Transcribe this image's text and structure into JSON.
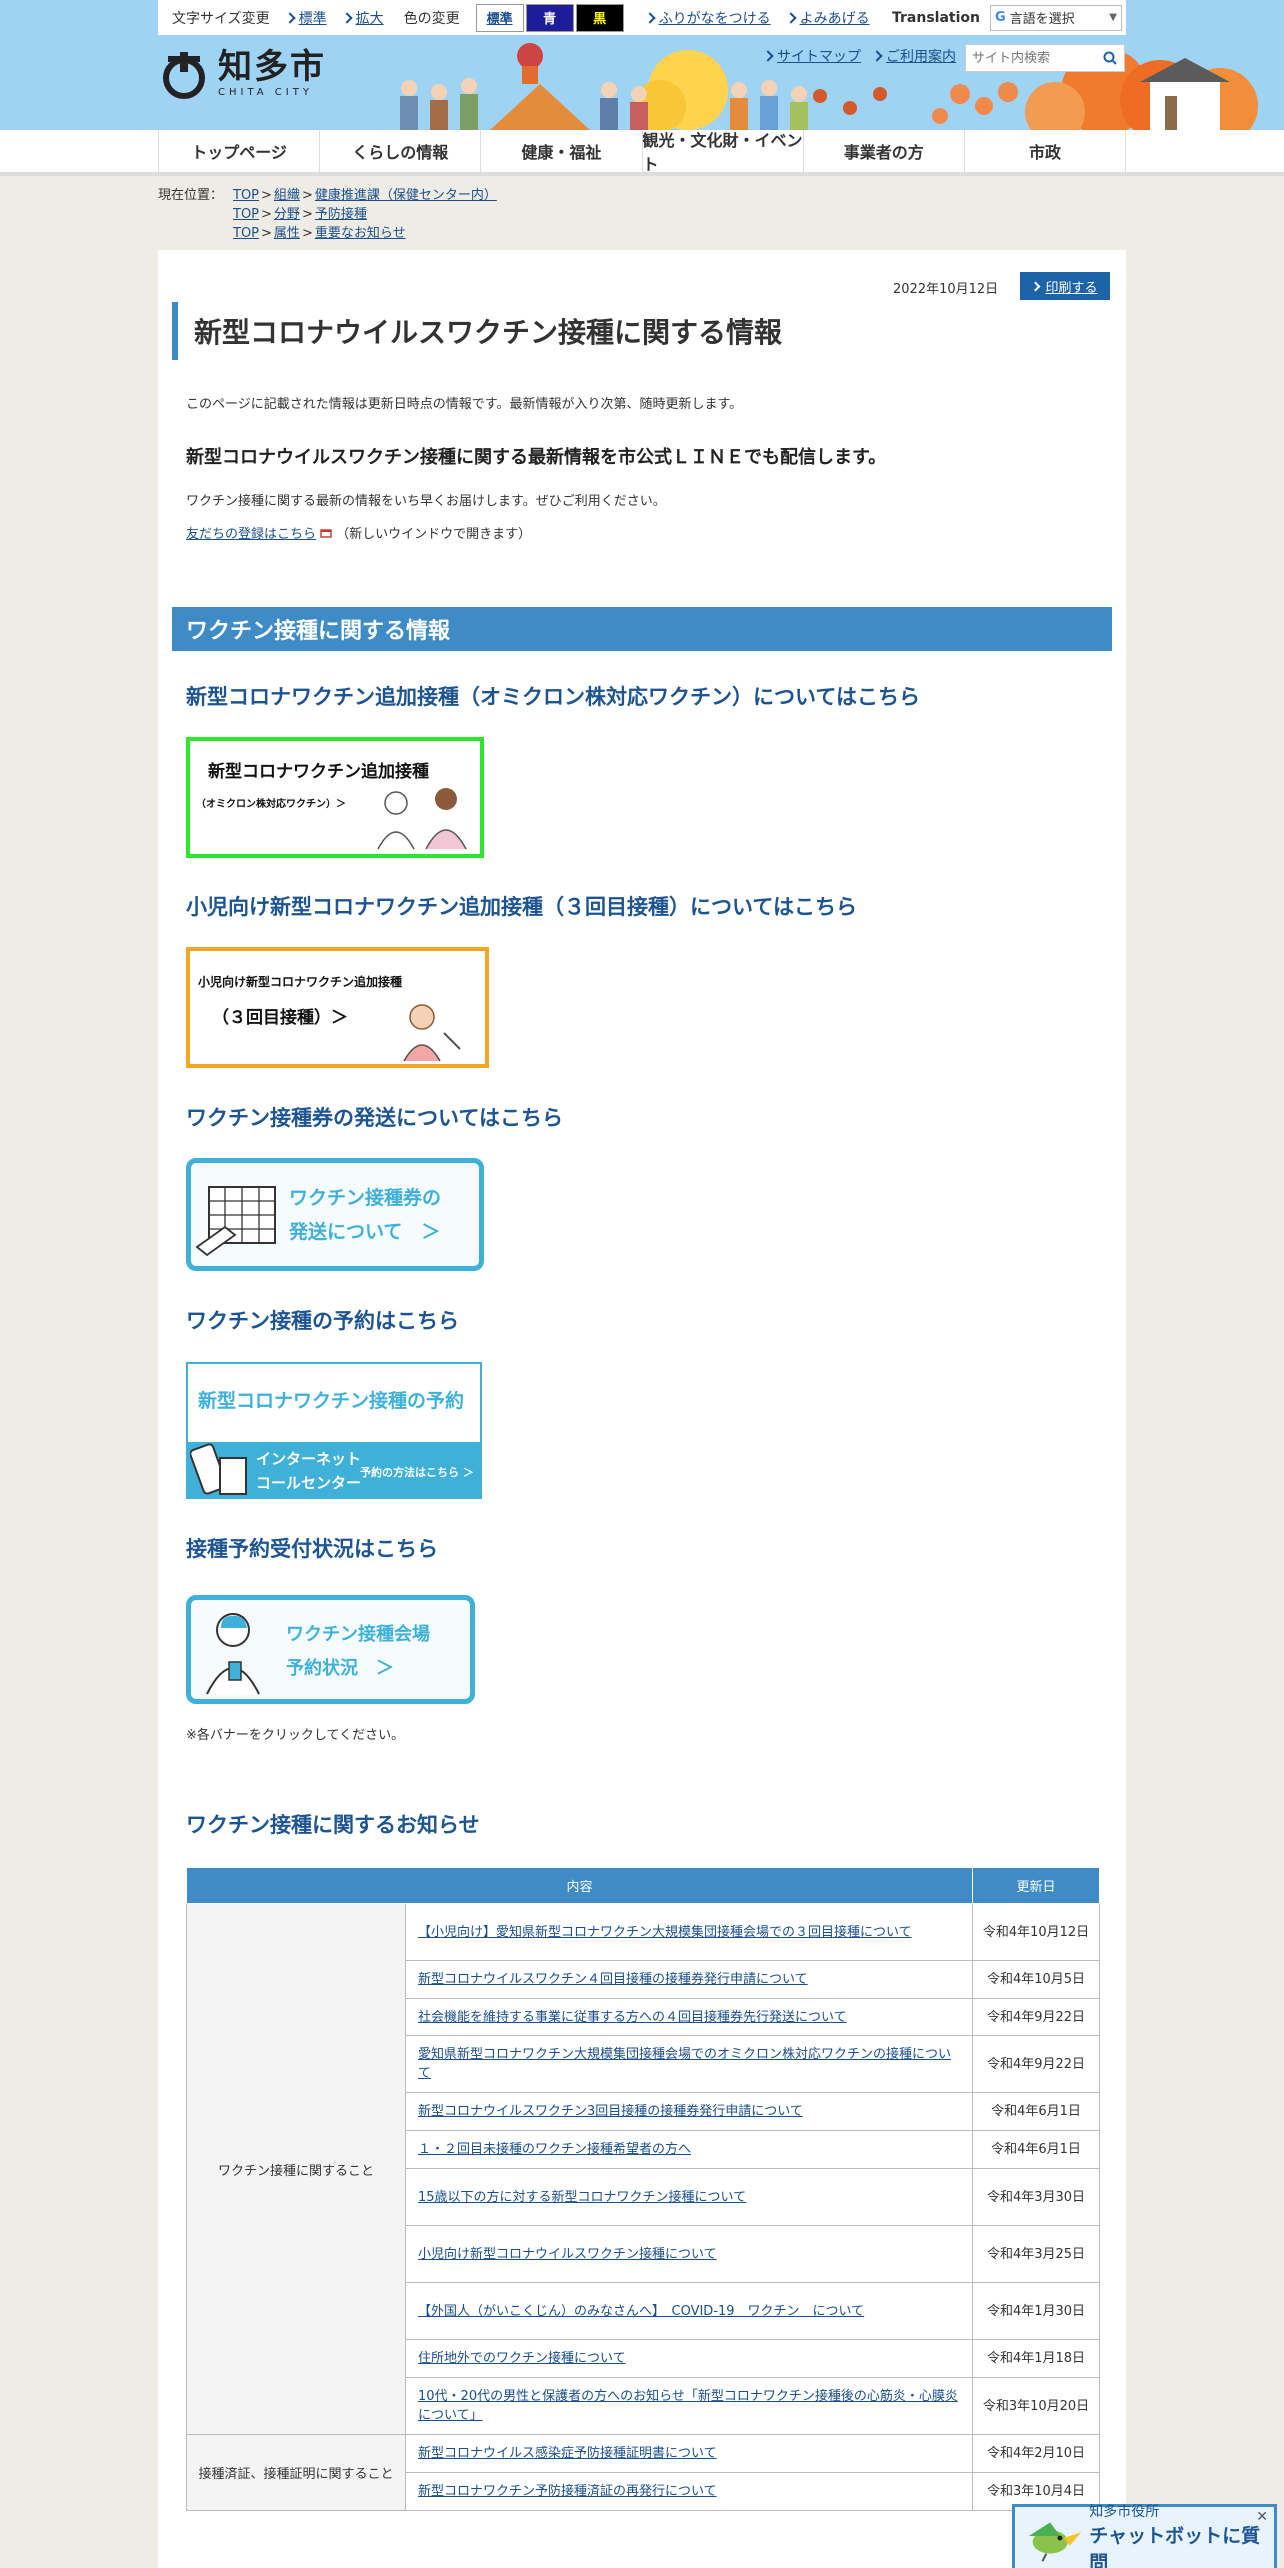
{
  "toolbar": {
    "font_size_label": "文字サイズ変更",
    "font_standard": "標準",
    "font_large": "拡大",
    "color_label": "色の変更",
    "color_standard": "標準",
    "color_blue": "青",
    "color_black": "黒",
    "furigana": "ふりがなをつける",
    "read_aloud": "よみあげる",
    "translation": "Translation",
    "language_select": "言語を選択"
  },
  "header": {
    "logo_jp": "知多市",
    "logo_en": "CHITA CITY",
    "sitemap": "サイトマップ",
    "guide": "ご利用案内",
    "search_placeholder": "サイト内検索"
  },
  "nav": [
    "トップページ",
    "くらしの情報",
    "健康・福祉",
    "観光・文化財・イベント",
    "事業者の方",
    "市政"
  ],
  "breadcrumb": {
    "label": "現在位置：",
    "rows": [
      [
        "TOP",
        "組織",
        "健康推進課（保健センター内）"
      ],
      [
        "TOP",
        "分野",
        "予防接種"
      ],
      [
        "TOP",
        "属性",
        "重要なお知らせ"
      ]
    ]
  },
  "page": {
    "date": "2022年10月12日",
    "print": "印刷する",
    "title": "新型コロナウイルスワクチン接種に関する情報",
    "intro": "このページに記載された情報は更新日時点の情報です。最新情報が入り次第、随時更新します。",
    "line_heading": "新型コロナウイルスワクチン接種に関する最新情報を市公式ＬＩＮＥでも配信します。",
    "line_desc": "ワクチン接種に関する最新の情報をいち早くお届けします。ぜひご利用ください。",
    "line_link": "友だちの登録はこちら",
    "line_link_note": "（新しいウインドウで開きます）",
    "section_title": "ワクチン接種に関する情報",
    "note": "※各バナーをクリックしてください。",
    "notice_title": "ワクチン接種に関するお知らせ"
  },
  "sections": [
    {
      "heading": "新型コロナワクチン追加接種（オミクロン株対応ワクチン）についてはこちら",
      "banner_line1": "新型コロナワクチン追加接種",
      "banner_line2": "（オミクロン株対応ワクチン）＞"
    },
    {
      "heading": "小児向け新型コロナワクチン追加接種（３回目接種）についてはこちら",
      "banner_line1": "小児向け新型コロナワクチン追加接種",
      "banner_line2": "（３回目接種）＞"
    },
    {
      "heading": "ワクチン接種券の発送についてはこちら",
      "banner_line1": "ワクチン接種券の",
      "banner_line2": "発送について　＞"
    },
    {
      "heading": "ワクチン接種の予約はこちら",
      "banner_line1": "新型コロナワクチン接種の予約",
      "banner_line2": "インターネット",
      "banner_line3": "コールセンター",
      "banner_line4": "予約の方法はこちら ＞"
    },
    {
      "heading": "接種予約受付状況はこちら",
      "banner_line1": "ワクチン接種会場",
      "banner_line2": "予約状況　＞"
    }
  ],
  "table": {
    "headers": [
      "内容",
      "更新日"
    ],
    "groups": [
      {
        "category": "ワクチン接種に関すること",
        "rows": [
          {
            "title": "【小児向け】愛知県新型コロナワクチン大規模集団接種会場での３回目接種について",
            "date": "令和4年10月12日"
          },
          {
            "title": "新型コロナウイルスワクチン４回目接種の接種券発行申請について",
            "date": "令和4年10月5日"
          },
          {
            "title": "社会機能を維持する事業に従事する方への４回目接種券先行発送について",
            "date": "令和4年9月22日"
          },
          {
            "title": "愛知県新型コロナワクチン大規模集団接種会場でのオミクロン株対応ワクチンの接種について",
            "date": "令和4年9月22日"
          },
          {
            "title": "新型コロナウイルスワクチン3回目接種の接種券発行申請について",
            "date": "令和4年6月1日"
          },
          {
            "title": "１・２回目未接種のワクチン接種希望者の方へ",
            "date": "令和4年6月1日"
          },
          {
            "title": "15歳以下の方に対する新型コロナワクチン接種について",
            "date": "令和4年3月30日"
          },
          {
            "title": "小児向け新型コロナウイルスワクチン接種について",
            "date": "令和4年3月25日"
          },
          {
            "title": "【外国人（がいこくじん）のみなさんへ】　COVID-19　ワクチン　について",
            "date": "令和4年1月30日"
          },
          {
            "title": "住所地外でのワクチン接種について",
            "date": "令和4年1月18日"
          },
          {
            "title": "10代・20代の男性と保護者の方へのお知らせ「新型コロナワクチン接種後の心筋炎・心膜炎について」",
            "date": "令和3年10月20日"
          }
        ]
      },
      {
        "category": "接種済証、接種証明に関すること",
        "rows": [
          {
            "title": "新型コロナウイルス感染症予防接種証明書について",
            "date": "令和4年2月10日"
          },
          {
            "title": "新型コロナワクチン予防接種済証の再発行について",
            "date": "令和3年10月4日"
          }
        ]
      }
    ]
  },
  "chat": {
    "small": "知多市役所",
    "big": "チャットボットに質問"
  },
  "colors": {
    "accent": "#3e8bc6",
    "link": "#1a4f8b",
    "heading": "#1e5591"
  }
}
